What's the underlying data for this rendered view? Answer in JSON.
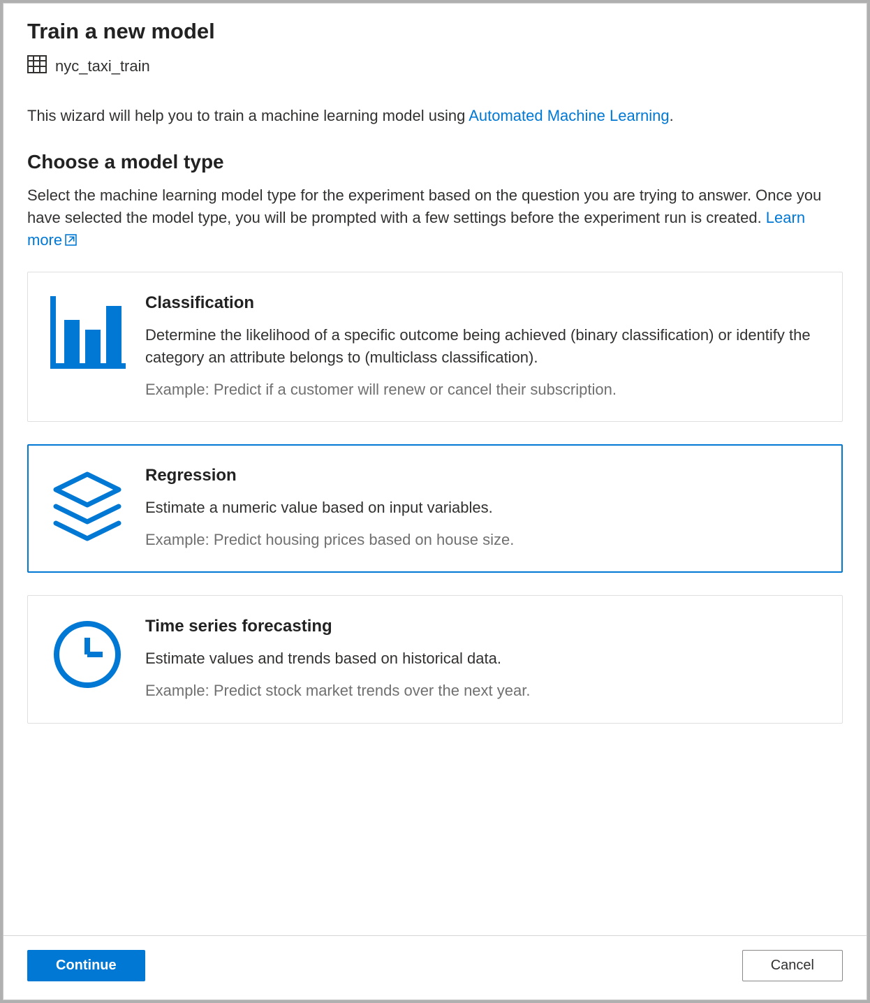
{
  "title": "Train a new model",
  "dataset": {
    "name": "nyc_taxi_train"
  },
  "intro": {
    "prefix": "This wizard will help you to train a machine learning model using ",
    "link": "Automated Machine Learning",
    "suffix": "."
  },
  "section": {
    "heading": "Choose a model type",
    "description_prefix": "Select the machine learning model type for the experiment based on the question you are trying to answer. Once you have selected the model type, you will be prompted with a few settings before the experiment run is created. ",
    "learn_more": "Learn more"
  },
  "cards": [
    {
      "id": "classification",
      "title": "Classification",
      "description": "Determine the likelihood of a specific outcome being achieved (binary classification) or identify the category an attribute belongs to (multiclass classification).",
      "example": "Example: Predict if a customer will renew or cancel their subscription.",
      "selected": false
    },
    {
      "id": "regression",
      "title": "Regression",
      "description": "Estimate a numeric value based on input variables.",
      "example": "Example: Predict housing prices based on house size.",
      "selected": true
    },
    {
      "id": "timeseries",
      "title": "Time series forecasting",
      "description": "Estimate values and trends based on historical data.",
      "example": "Example: Predict stock market trends over the next year.",
      "selected": false
    }
  ],
  "footer": {
    "continue": "Continue",
    "cancel": "Cancel"
  }
}
